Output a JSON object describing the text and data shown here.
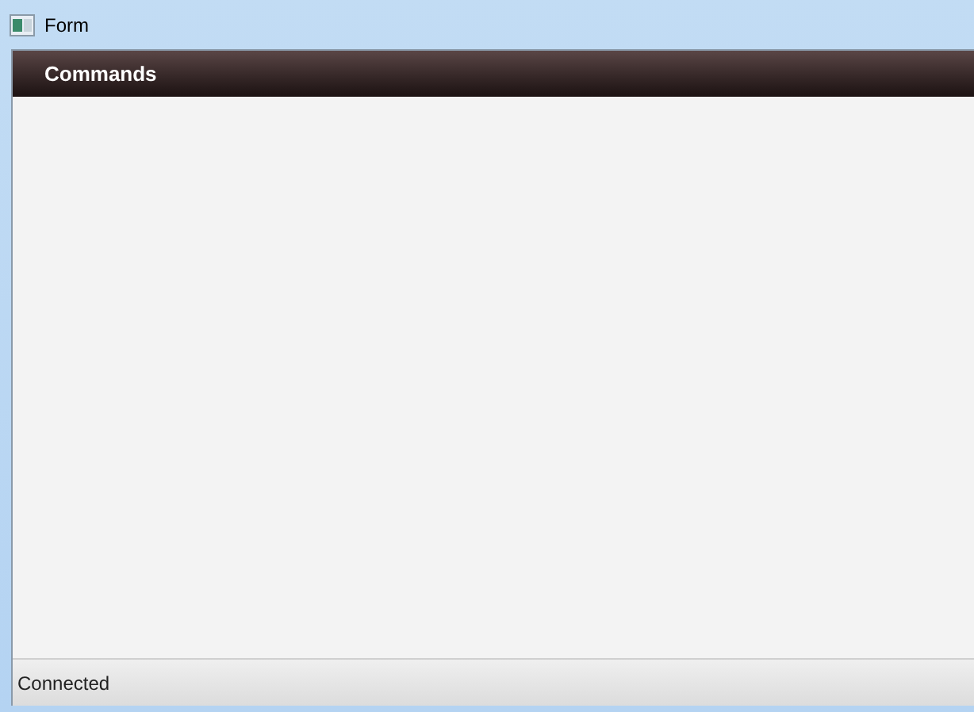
{
  "window": {
    "title": "Form"
  },
  "header": {
    "title": "Commands"
  },
  "status_bar": {
    "text": "Connected"
  }
}
